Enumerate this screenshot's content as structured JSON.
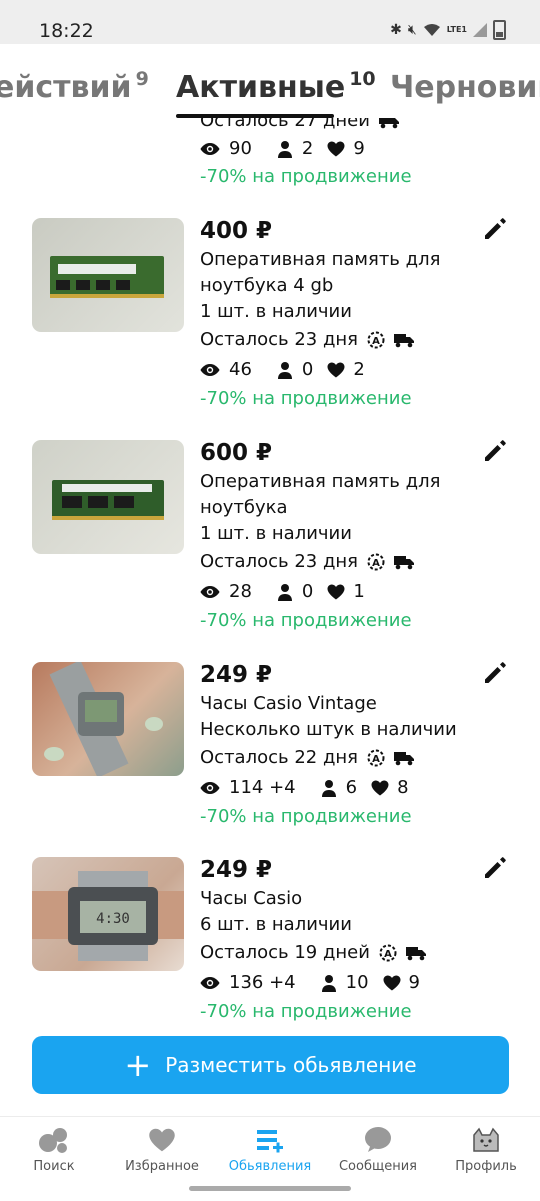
{
  "status_bar": {
    "time": "18:22",
    "network": "LTE1"
  },
  "tabs": [
    {
      "label": "ействий",
      "count": "9"
    },
    {
      "label": "Активные",
      "count": "10",
      "active": true
    },
    {
      "label": "Черновики",
      "count": ""
    }
  ],
  "items": [
    {
      "remaining": "Осталось 27 дней",
      "views": "90",
      "contacts": "2",
      "likes": "9",
      "promo": "-70% на продвижение"
    },
    {
      "price": "400 ₽",
      "title_line1": "Оперативная память для",
      "title_line2": "ноутбука 4 gb",
      "stock": "1 шт. в наличии",
      "remaining": "Осталось 23 дня",
      "views": "46",
      "contacts": "0",
      "likes": "2",
      "promo": "-70% на продвижение"
    },
    {
      "price": "600 ₽",
      "title_line1": "Оперативная память для",
      "title_line2": "ноутбука",
      "stock": "1 шт. в наличии",
      "remaining": "Осталось 23 дня",
      "views": "28",
      "contacts": "0",
      "likes": "1",
      "promo": "-70% на продвижение"
    },
    {
      "price": "249 ₽",
      "title_line1": "Часы Casio Vintage",
      "stock": "Несколько штук в наличии",
      "remaining": "Осталось 22 дня",
      "views": "114 +4",
      "contacts": "6",
      "likes": "8",
      "promo": "-70% на продвижение"
    },
    {
      "price": "249 ₽",
      "title_line1": "Часы Casio",
      "stock": "6 шт. в наличии",
      "remaining": "Осталось 19 дней",
      "views": "136 +4",
      "contacts": "10",
      "likes": "9",
      "promo": "-70% на продвижение"
    }
  ],
  "post_button": {
    "label": "Разместить обьявление"
  },
  "bottom_nav": [
    {
      "label": "Поиск",
      "icon": "search-bubbles-icon"
    },
    {
      "label": "Избранное",
      "icon": "heart-icon"
    },
    {
      "label": "Обьявления",
      "icon": "listings-add-icon",
      "active": true
    },
    {
      "label": "Сообщения",
      "icon": "chat-bubble-icon"
    },
    {
      "label": "Профиль",
      "icon": "cat-avatar-icon"
    }
  ],
  "colors": {
    "accent": "#1aa4f0",
    "promo": "#29b86d",
    "status_bar_bg": "#eeeeee"
  }
}
